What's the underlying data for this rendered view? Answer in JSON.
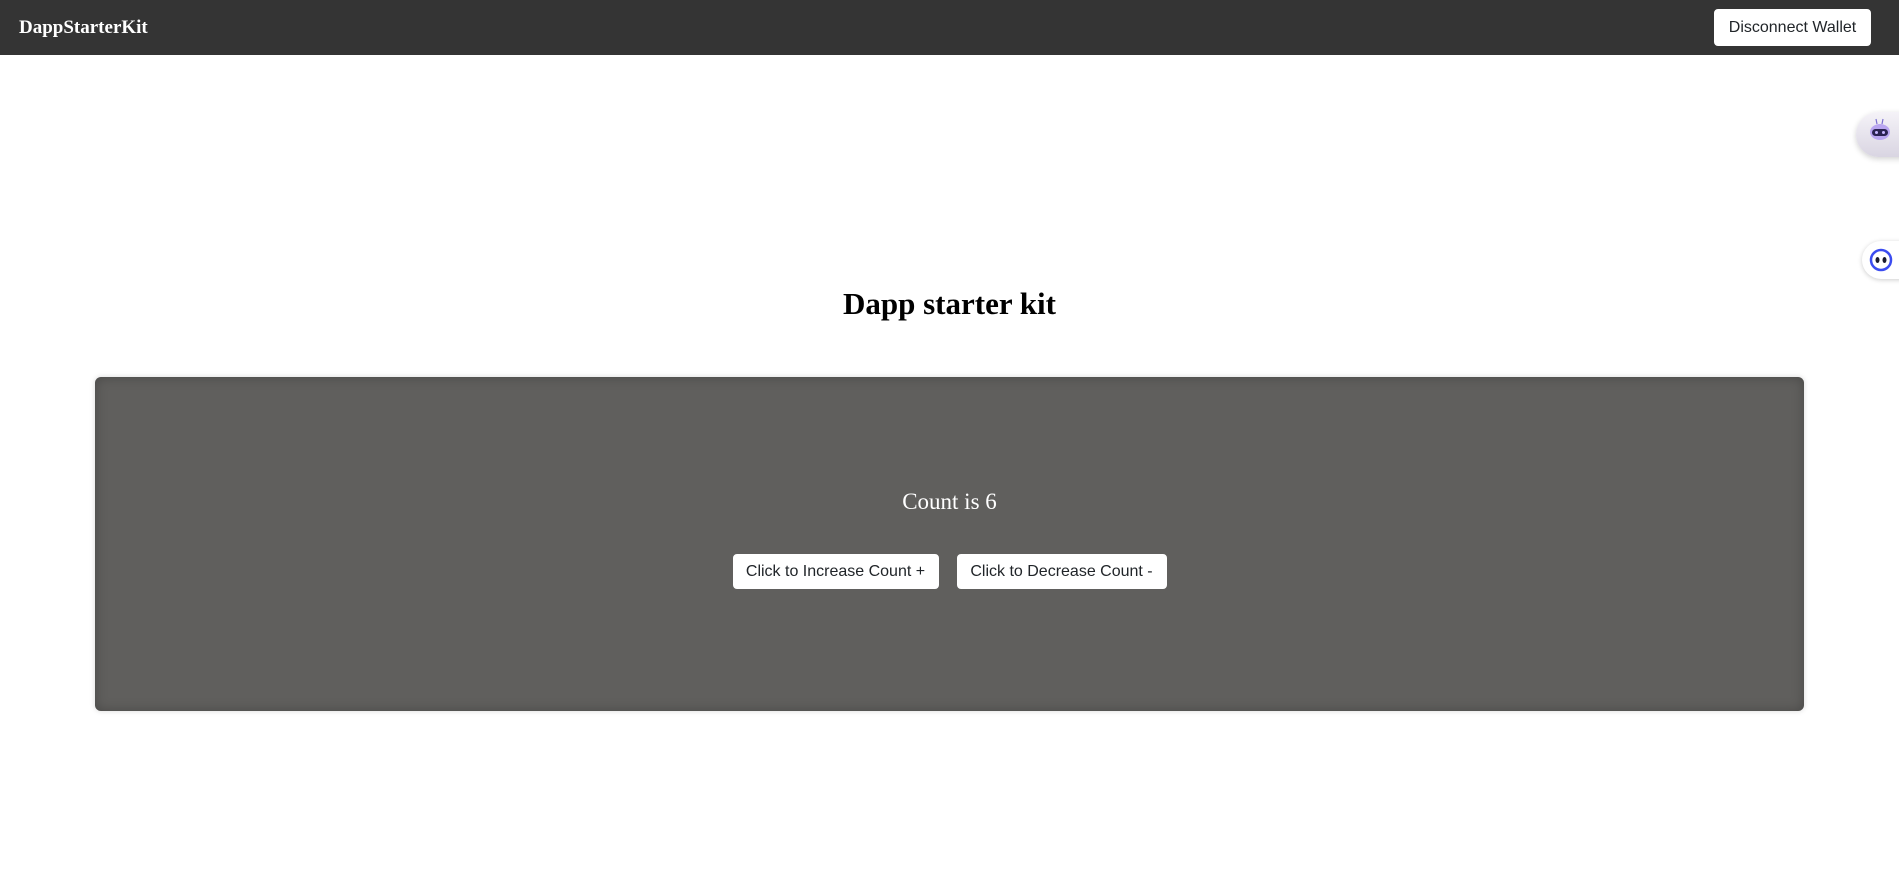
{
  "navbar": {
    "brand": "DappStarterKit",
    "disconnect_label": "Disconnect Wallet"
  },
  "main": {
    "title": "Dapp starter kit",
    "count_text": "Count is 6",
    "increase_label": "Click to Increase Count +",
    "decrease_label": "Click to Decrease Count -"
  },
  "floating": {
    "bot_icon": "robot-icon",
    "assistant_icon": "assistant-face-icon"
  },
  "colors": {
    "navbar_bg": "#343434",
    "card_bg": "#605f5d",
    "accent_purple": "#7b3fe4",
    "accent_blue": "#3b4cf0"
  }
}
